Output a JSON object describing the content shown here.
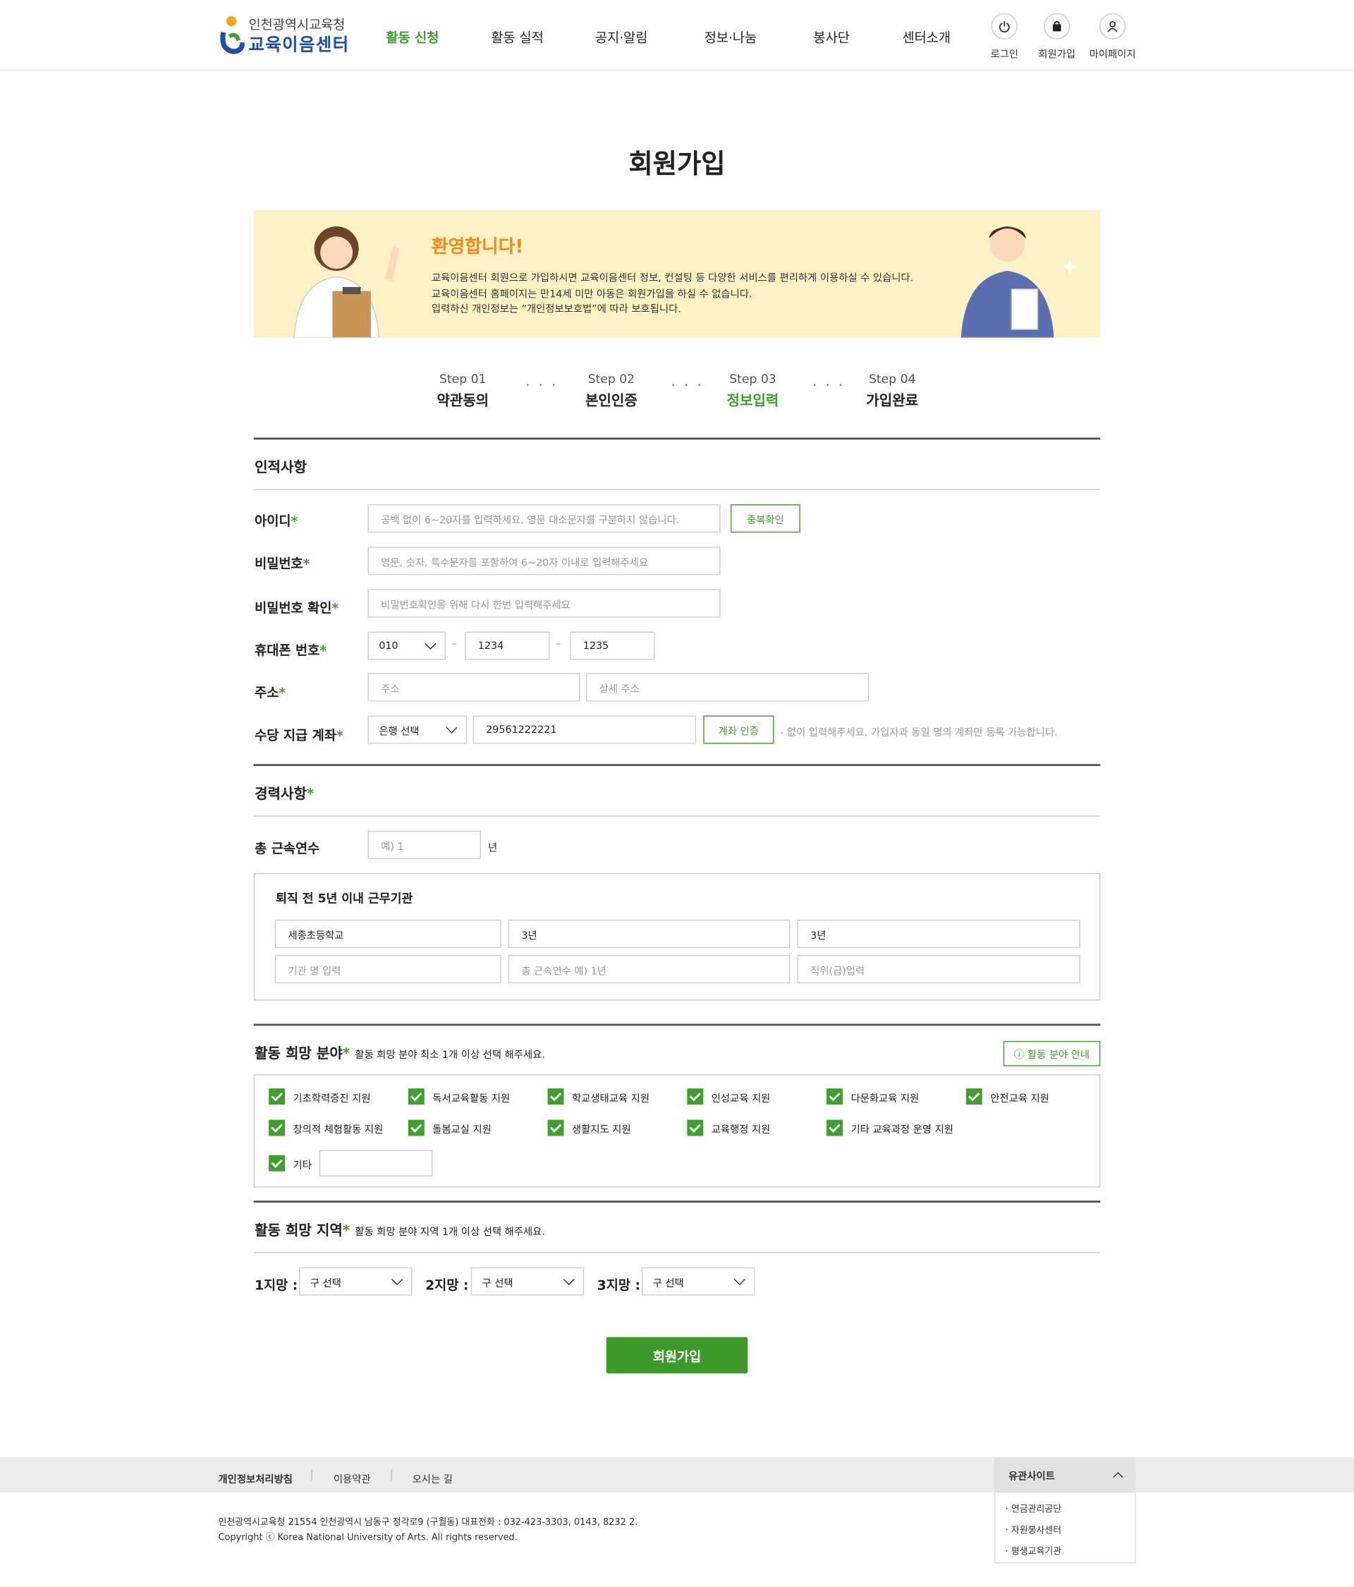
{
  "header": {
    "logo_top": "인천광역시교육청",
    "logo_main": "교육이음센터",
    "nav": [
      "활동 신청",
      "활동 실적",
      "공지·알림",
      "정보·나눔",
      "봉사단",
      "센터소개"
    ],
    "tools": {
      "login": "로그인",
      "join": "회원가입",
      "mypage": "마이페이지"
    }
  },
  "page_title": "회원가입",
  "banner": {
    "welcome": "환영합니다!",
    "lines": [
      "교육이음센터 회원으로 가입하시면 교육이음센터 정보, 컨설팅 등 다양한 서비스를 편리하게 이용하실 수 있습니다.",
      "교육이음센터 홈페이지는 만14세 미만 아동은 회원가입을 하실 수 없습니다.",
      "입력하신 개인정보는 “개인정보보호법”에 따라 보호됩니다."
    ]
  },
  "steps": [
    {
      "num": "Step 01",
      "label": "약관동의"
    },
    {
      "num": "Step 02",
      "label": "본인인증"
    },
    {
      "num": "Step 03",
      "label": "정보입력"
    },
    {
      "num": "Step 04",
      "label": "가입완료"
    }
  ],
  "steps_sep": "· · ·",
  "personal": {
    "title": "인적사항",
    "id": {
      "label": "아이디",
      "placeholder": "공백 없이 6~20자를 입력하세요. 영문 대소문자를 구분하지 않습니다.",
      "button": "중복확인"
    },
    "pw": {
      "label": "비밀번호",
      "placeholder": "영문, 숫자, 특수문자를 포함하여 6~20자 이내로 입력해주세요"
    },
    "pw2": {
      "label": "비밀번호 확인",
      "placeholder": "비밀번호확인을 위해 다시 한번 입력해주세요"
    },
    "phone": {
      "label": "휴대폰 번호",
      "prefix": "010",
      "mid": "1234",
      "last": "1235",
      "dash": "–"
    },
    "address": {
      "label": "주소",
      "ph1": "주소",
      "ph2": "상세 주소"
    },
    "account": {
      "label": "수당 지급 계좌",
      "bank": "은행 선택",
      "number": "29561222221",
      "button": "계좌 인증",
      "note": "- 없이 입력해주세요. 가입자과 동일 명의 계좌만 등록 가능합니다."
    }
  },
  "career": {
    "title": "경력사항",
    "years_label": "총 근속연수",
    "years_ph": "예) 1",
    "years_unit": "년",
    "box_title": "퇴직 전 5년 이내 근무기관",
    "row1": [
      "세종초등학교",
      "3년",
      "3년"
    ],
    "row2": [
      "기관 명 입력",
      "총 근속연수 예) 1년",
      "직위(급)입력"
    ]
  },
  "fields": {
    "title": "활동 희망 분야",
    "sub": "활동 희망 분야 최소 1개 이상 선택 해주세요.",
    "guide": "ⓘ 활동 분야 안내",
    "row1": [
      "기초학력증진 지원",
      "독서교육활동 지원",
      "학교생태교육 지원",
      "인성교육 지원",
      "다문화교육 지원",
      "안전교육 지원"
    ],
    "row2": [
      "창의적 체험활동 지원",
      "돌봄교실 지원",
      "생활지도 지원",
      "교육행정 지원",
      "기타 교육과정 운영 지원"
    ],
    "etc": "기타"
  },
  "regions": {
    "title": "활동 희망 지역",
    "sub": "활동 희망 분야 지역 1개 이상 선택 해주세요.",
    "items": [
      {
        "label": "1지망 :",
        "value": "구 선택"
      },
      {
        "label": "2지망 :",
        "value": "구 선택"
      },
      {
        "label": "3지망 :",
        "value": "구 선택"
      }
    ]
  },
  "submit": "회원가입",
  "required_mark": "*",
  "footer": {
    "links": [
      "개인정보처리방침",
      "이용약관",
      "오시는 길"
    ],
    "related": "유관사이트",
    "related_items": [
      "· 연금관리공단",
      "· 자원봉사센터",
      "· 평생교육기관"
    ],
    "address": "인천광역시교육청 21554 인천광역시 남동구 정각로9 (구월동) 대표전화 : 032-423-3303, 0143, 8232 2.",
    "copyright": "Copyright ⓒ Korea National University of Arts. All rights reserved."
  },
  "colors": {
    "accent": "#3fa02e",
    "banner": "#fdf2c4",
    "logo_blue": "#1b4fa8",
    "welcome": "#f28a1b"
  },
  "icons": [
    "power-icon",
    "bag-icon",
    "user-icon",
    "chevron-down-icon",
    "check-icon",
    "chevron-up-icon"
  ]
}
